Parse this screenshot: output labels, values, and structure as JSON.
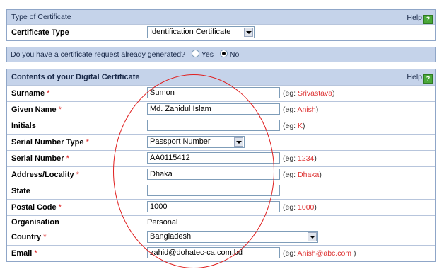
{
  "certificate_type_panel": {
    "header": "Type of Certificate",
    "help_label": "Help",
    "row_label": "Certificate Type",
    "selected": "Identification Certificate"
  },
  "request_question": {
    "text": "Do you have a certificate request already generated?",
    "yes_label": "Yes",
    "no_label": "No",
    "selected": "No"
  },
  "contents_panel": {
    "header": "Contents of your Digital Certificate",
    "help_label": "Help",
    "rows": {
      "surname": {
        "label": "Surname",
        "required": "*",
        "value": "Sumon",
        "hint_prefix": "(eg: ",
        "hint_example": "Srivastava",
        "hint_suffix": ")"
      },
      "given_name": {
        "label": "Given Name",
        "required": "*",
        "value": "Md. Zahidul Islam",
        "hint_prefix": "(eg: ",
        "hint_example": "Anish",
        "hint_suffix": ")"
      },
      "initials": {
        "label": "Initials",
        "required": "",
        "value": "",
        "hint_prefix": "(eg: ",
        "hint_example": "K",
        "hint_suffix": ")"
      },
      "serial_type": {
        "label": "Serial Number Type",
        "required": "*",
        "value": "Passport Number"
      },
      "serial_number": {
        "label": "Serial Number",
        "required": "*",
        "value": "AA0115412",
        "hint_prefix": "(eg: ",
        "hint_example": "1234",
        "hint_suffix": ")"
      },
      "address": {
        "label": "Address/Locality",
        "required": "*",
        "value": "Dhaka",
        "hint_prefix": "(eg: ",
        "hint_example": "Dhaka",
        "hint_suffix": ")"
      },
      "state": {
        "label": "State",
        "required": "",
        "value": ""
      },
      "postal_code": {
        "label": "Postal Code",
        "required": "*",
        "value": "1000",
        "hint_prefix": "(eg: ",
        "hint_example": "1000",
        "hint_suffix": ")"
      },
      "organisation": {
        "label": "Organisation",
        "required": "",
        "value": "Personal"
      },
      "country": {
        "label": "Country",
        "required": "*",
        "value": "Bangladesh"
      },
      "email": {
        "label": "Email",
        "required": "*",
        "value": "zahid@dohatec-ca.com.bd",
        "hint_prefix": "(eg: ",
        "hint_example": "Anish@abc.com",
        "hint_suffix": " )"
      }
    }
  },
  "colors": {
    "panel_header_bg": "#c5d3ea",
    "required_marker": "#dd2222",
    "annotation_circle": "#e02020",
    "help_icon": "#4aa83a"
  }
}
